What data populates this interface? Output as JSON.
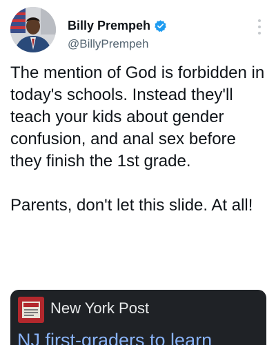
{
  "author": {
    "display_name": "Billy Prempeh",
    "handle": "@BillyPrempeh",
    "verified_icon": "verified-badge-icon",
    "avatar_icon": "profile-photo",
    "verified_color": "#1d9bf0"
  },
  "more_icon": "more-options-icon",
  "tweet": {
    "text": "The mention of God is forbidden in today's schools. Instead they'll teach your kids about gender confusion, and anal sex before they finish the 1st grade.\n\nParents, don't let this slide. At all!"
  },
  "card": {
    "logo_icon": "new-york-post-logo",
    "source": "New York Post",
    "title": "NJ first-graders to learn",
    "background": "#1f2226",
    "link_color": "#8ab4f8"
  }
}
